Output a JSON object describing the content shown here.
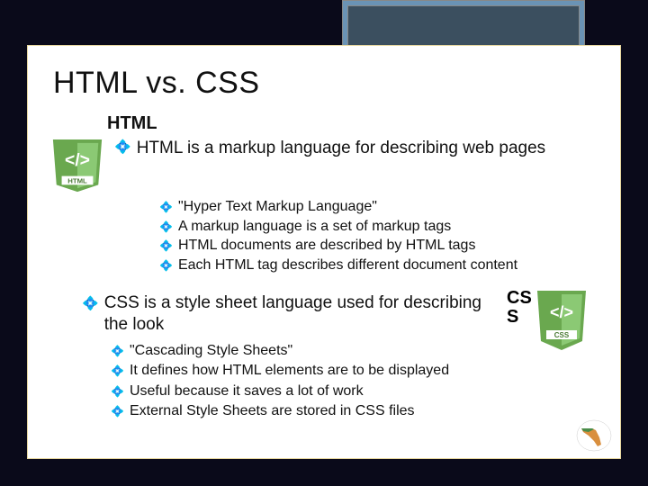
{
  "title": "HTML vs. CSS",
  "html_section": {
    "heading": "HTML",
    "intro": "HTML is a markup language for describing web pages",
    "points": [
      "\"Hyper Text Markup Language\"",
      "A markup language is a set of markup tags",
      "HTML documents are described by HTML tags",
      "Each HTML tag describes different document content"
    ]
  },
  "css_section": {
    "side_label": "CS S",
    "intro": "CSS is a style sheet language used for describing the look",
    "points": [
      "\"Cascading Style Sheets\"",
      "It defines how HTML elements are to be displayed",
      "Useful because it saves a lot of work",
      "External Style Sheets are stored in CSS files"
    ]
  },
  "icons": {
    "html_badge": "html-logo",
    "css_badge": "css-logo",
    "corner": "florida-map"
  }
}
